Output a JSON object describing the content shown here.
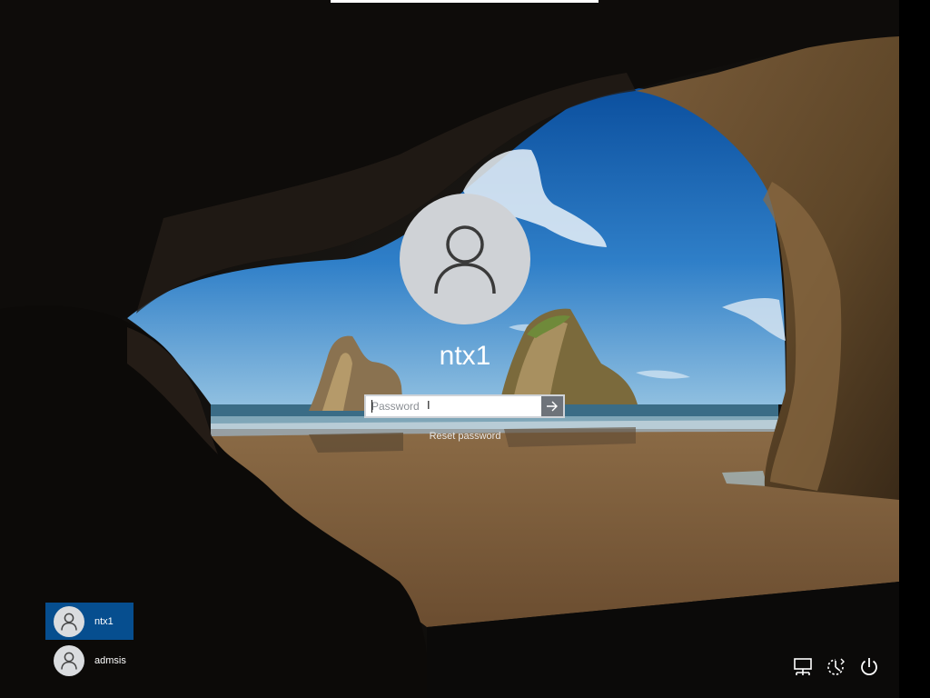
{
  "login": {
    "username": "ntx1",
    "password_placeholder": "Password",
    "reset_label": "Reset password"
  },
  "users": [
    {
      "name": "ntx1",
      "selected": true
    },
    {
      "name": "admsis",
      "selected": false
    }
  ],
  "icons": {
    "avatar": "user-icon",
    "submit": "arrow-right-icon",
    "network": "network-icon",
    "accessibility": "ease-of-access-icon",
    "power": "power-icon"
  },
  "colors": {
    "selected_user": "#064e8f",
    "avatar_bg": "#cfd2d6",
    "submit_bg": "#6e737a"
  }
}
